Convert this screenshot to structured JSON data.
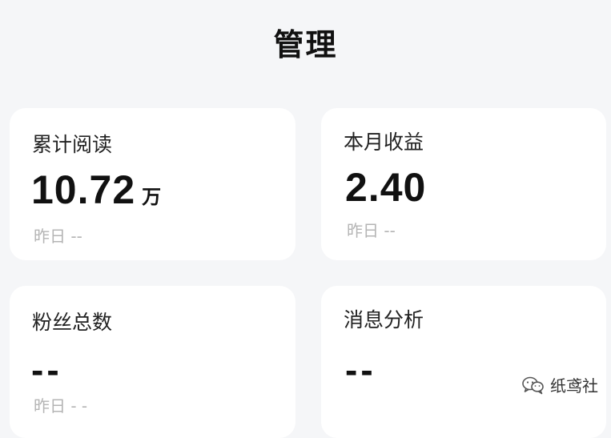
{
  "header": {
    "title": "管理"
  },
  "cards": [
    {
      "label": "累计阅读",
      "value": "10.72",
      "unit": "万",
      "sub": "昨日 --"
    },
    {
      "label": "本月收益",
      "value": "2.40",
      "unit": "",
      "sub": "昨日 --"
    },
    {
      "label": "粉丝总数",
      "value": "--",
      "unit": "",
      "sub": "昨日 - -"
    },
    {
      "label": "消息分析",
      "value": "--",
      "unit": "",
      "sub": ""
    }
  ],
  "watermark": {
    "text": "纸鸢社",
    "icon": "wechat-icon"
  },
  "colors": {
    "background": "#f5f6f8",
    "card": "#ffffff",
    "subtext": "#b4b4b4"
  }
}
